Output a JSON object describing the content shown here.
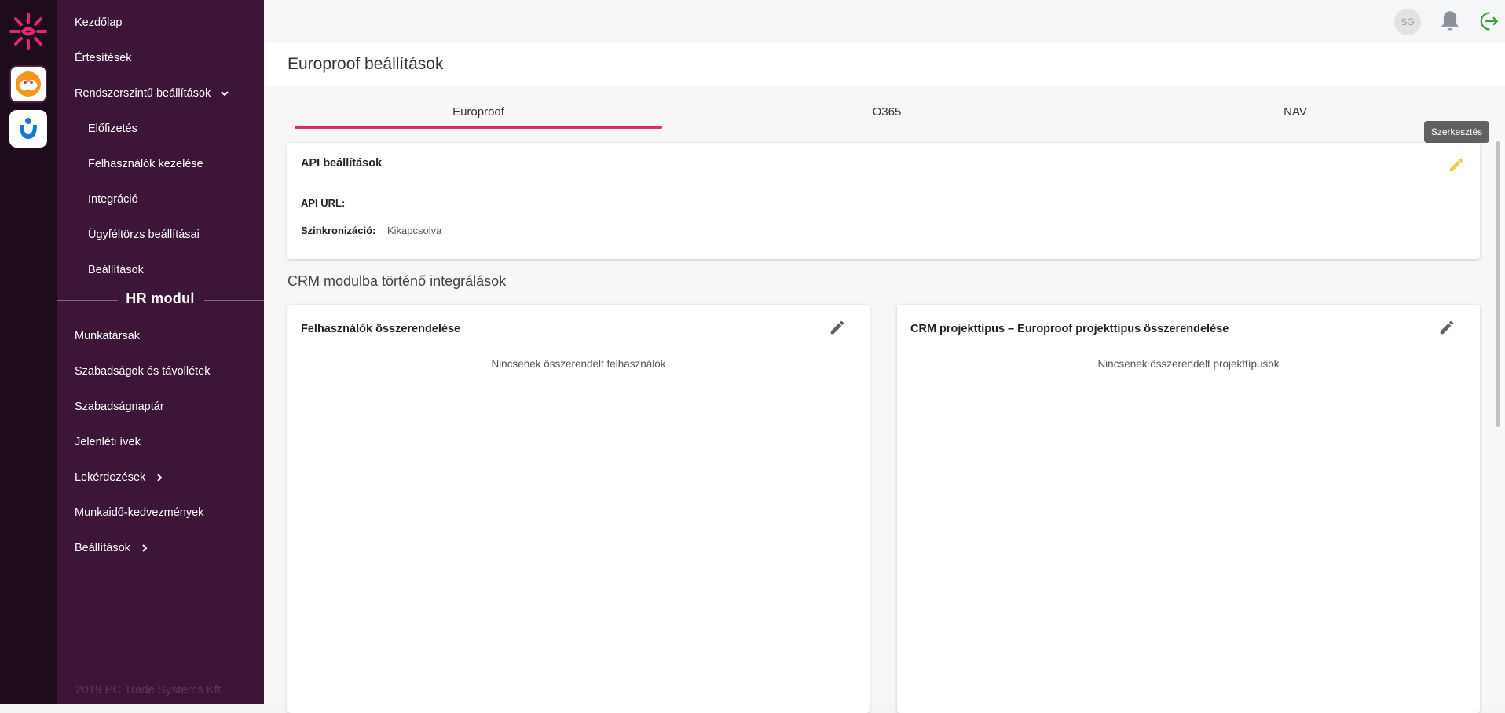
{
  "sidebar": {
    "items": [
      {
        "label": "Kezdőlap"
      },
      {
        "label": "Értesítések"
      },
      {
        "label": "Rendszerszintű beállítások"
      },
      {
        "label": "Előfizetés"
      },
      {
        "label": "Felhasználók kezelése"
      },
      {
        "label": "Integráció"
      },
      {
        "label": "Ügyféltörzs beállításai"
      },
      {
        "label": "Beállítások"
      }
    ],
    "hr_title": "HR modul",
    "hr_items": [
      {
        "label": "Munkatársak"
      },
      {
        "label": "Szabadságok és távollétek"
      },
      {
        "label": "Szabadságnaptár"
      },
      {
        "label": "Jelenléti ívek"
      },
      {
        "label": "Lekérdezések"
      },
      {
        "label": "Munkaidő-kedvezmények"
      },
      {
        "label": "Beállítások"
      }
    ],
    "footer": "2019 PC Trade Systems Kft."
  },
  "topbar": {
    "avatar_initials": "SG",
    "icons": [
      "bell-icon",
      "logout-icon"
    ]
  },
  "page": {
    "title": "Europroof beállítások"
  },
  "tabs": [
    {
      "label": "Europroof",
      "active": true
    },
    {
      "label": "O365",
      "active": false
    },
    {
      "label": "NAV",
      "active": false
    }
  ],
  "tooltip": "Szerkesztés",
  "api_card": {
    "title": "API beállítások",
    "api_url_label": "API URL:",
    "api_url_value": "",
    "sync_label": "Szinkronizáció:",
    "sync_value": "Kikapcsolva"
  },
  "crm_section": {
    "title": "CRM modulba történő integrálások",
    "users_card": {
      "title": "Felhasználók összerendelése",
      "empty": "Nincsenek összerendelt felhasználók"
    },
    "projects_card": {
      "title": "CRM projekttípus – Europroof projekttípus összerendelése",
      "empty": "Nincsenek összerendelt projekttípusok"
    }
  },
  "colors": {
    "accent": "#e0286b",
    "sidebar": "#3d1539",
    "rail": "#1e0c1c",
    "edit_active": "#f2c94c"
  }
}
